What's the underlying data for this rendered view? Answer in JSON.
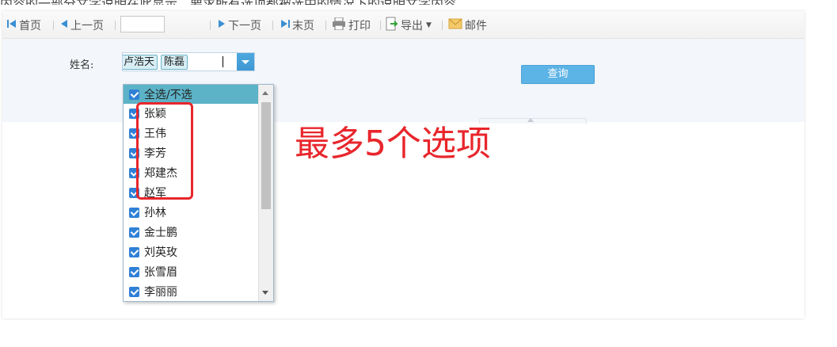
{
  "toolbar": {
    "first_page": "首页",
    "prev_page": "上一页",
    "page_input_value": "",
    "next_page": "下一页",
    "last_page": "末页",
    "print": "打印",
    "export": "导出",
    "mail": "邮件"
  },
  "search": {
    "name_label": "姓名:",
    "selected_tags": [
      "浩",
      "卢浩天",
      "陈磊"
    ],
    "query_button": "查询"
  },
  "dropdown": {
    "select_all": "全选/不选",
    "options": [
      "张颖",
      "王伟",
      "李芳",
      "郑建杰",
      "赵军",
      "孙林",
      "金士鹏",
      "刘英玫",
      "张雪眉",
      "李丽丽"
    ]
  },
  "annotation": {
    "text": "最多5个选项",
    "color": "#e8262c"
  },
  "colors": {
    "accent": "#5cb3e6",
    "checkbox": "#2f80d6",
    "highlight_row": "#5cb3c7"
  }
}
